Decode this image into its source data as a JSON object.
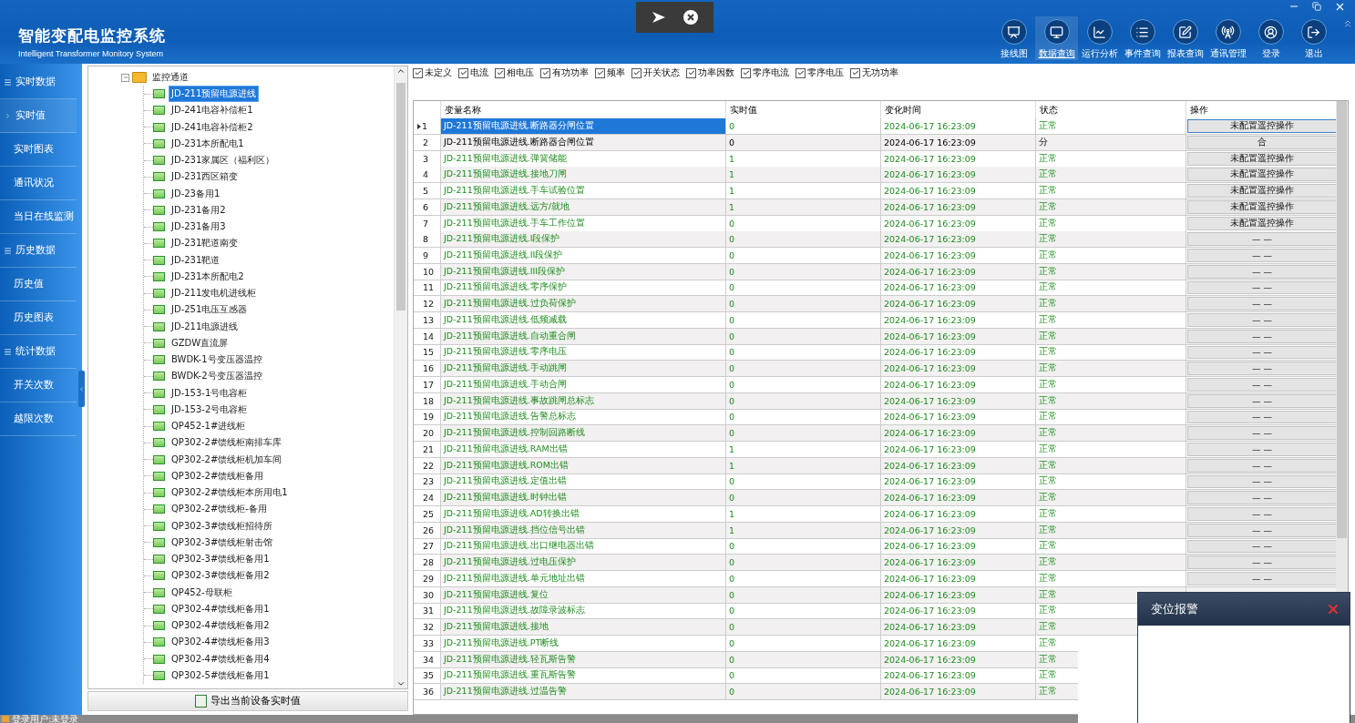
{
  "header": {
    "title": "智能变配电监控系统",
    "subtitle": "Intelligent Transformer Monitory System"
  },
  "toolbar": [
    {
      "label": "接线图",
      "selected": false
    },
    {
      "label": "数据查询",
      "selected": true
    },
    {
      "label": "运行分析",
      "selected": false
    },
    {
      "label": "事件查询",
      "selected": false
    },
    {
      "label": "报表查询",
      "selected": false
    },
    {
      "label": "通讯管理",
      "selected": false
    },
    {
      "label": "登录",
      "selected": false
    },
    {
      "label": "退出",
      "selected": false
    }
  ],
  "nav": [
    {
      "label": "实时数据",
      "kind": "section",
      "selected": false
    },
    {
      "label": "实时值",
      "kind": "item",
      "selected": true
    },
    {
      "label": "实时图表",
      "kind": "item",
      "selected": false
    },
    {
      "label": "通讯状况",
      "kind": "item",
      "selected": false
    },
    {
      "label": "当日在线监测",
      "kind": "item",
      "selected": false
    },
    {
      "label": "历史数据",
      "kind": "section",
      "selected": false
    },
    {
      "label": "历史值",
      "kind": "item",
      "selected": false
    },
    {
      "label": "历史图表",
      "kind": "item",
      "selected": false
    },
    {
      "label": "统计数据",
      "kind": "section",
      "selected": false
    },
    {
      "label": "开关次数",
      "kind": "item",
      "selected": false
    },
    {
      "label": "越限次数",
      "kind": "item",
      "selected": false
    }
  ],
  "tree": {
    "label": "监控通道",
    "expanded": true,
    "children": [
      {
        "label": "JD-211预留电源进线",
        "selected": true
      },
      {
        "label": "JD-241电容补偿柜1",
        "selected": false
      },
      {
        "label": "JD-241电容补偿柜2",
        "selected": false
      },
      {
        "label": "JD-231本所配电1",
        "selected": false
      },
      {
        "label": "JD-231家属区（福利区）",
        "selected": false
      },
      {
        "label": "JD-231西区箱变",
        "selected": false
      },
      {
        "label": "JD-23备用1",
        "selected": false
      },
      {
        "label": "JD-231备用2",
        "selected": false
      },
      {
        "label": "JD-231备用3",
        "selected": false
      },
      {
        "label": "JD-231靶道南变",
        "selected": false
      },
      {
        "label": "JD-231靶道",
        "selected": false
      },
      {
        "label": "JD-231本所配电2",
        "selected": false
      },
      {
        "label": "JD-211发电机进线柜",
        "selected": false
      },
      {
        "label": "JD-251电压互感器",
        "selected": false
      },
      {
        "label": "JD-211电源进线",
        "selected": false
      },
      {
        "label": "GZDW直流屏",
        "selected": false
      },
      {
        "label": "BWDK-1号变压器温控",
        "selected": false
      },
      {
        "label": "BWDK-2号变压器温控",
        "selected": false
      },
      {
        "label": "JD-153-1号电容柜",
        "selected": false
      },
      {
        "label": "JD-153-2号电容柜",
        "selected": false
      },
      {
        "label": "QP452-1#进线柜",
        "selected": false
      },
      {
        "label": "QP302-2#馈线柜南排车库",
        "selected": false
      },
      {
        "label": "QP302-2#馈线柜机加车间",
        "selected": false
      },
      {
        "label": "QP302-2#馈线柜备用",
        "selected": false
      },
      {
        "label": "QP302-2#馈线柜本所用电1",
        "selected": false
      },
      {
        "label": "QP302-2#馈线柜-备用",
        "selected": false
      },
      {
        "label": "QP302-3#馈线柜招待所",
        "selected": false
      },
      {
        "label": "QP302-3#馈线柜射击馆",
        "selected": false
      },
      {
        "label": "QP302-3#馈线柜备用1",
        "selected": false
      },
      {
        "label": "QP302-3#馈线柜备用2",
        "selected": false
      },
      {
        "label": "QP452-母联柜",
        "selected": false
      },
      {
        "label": "QP302-4#馈线柜备用1",
        "selected": false
      },
      {
        "label": "QP302-4#馈线柜备用2",
        "selected": false
      },
      {
        "label": "QP302-4#馈线柜备用3",
        "selected": false
      },
      {
        "label": "QP302-4#馈线柜备用4",
        "selected": false
      },
      {
        "label": "QP302-5#馈线柜备用1",
        "selected": false
      }
    ]
  },
  "export_button": "导出当前设备实时值",
  "filters": [
    {
      "label": "未定义",
      "checked": true
    },
    {
      "label": "电流",
      "checked": true
    },
    {
      "label": "相电压",
      "checked": true
    },
    {
      "label": "有功功率",
      "checked": true
    },
    {
      "label": "频率",
      "checked": true
    },
    {
      "label": "开关状态",
      "checked": true
    },
    {
      "label": "功率因数",
      "checked": true
    },
    {
      "label": "零序电流",
      "checked": true
    },
    {
      "label": "零序电压",
      "checked": true
    },
    {
      "label": "无功功率",
      "checked": true
    }
  ],
  "table": {
    "columns": [
      "变量名称",
      "实时值",
      "变化时间",
      "状态",
      "操作"
    ],
    "rows": [
      {
        "num": "1",
        "name": "JD-211预留电源进线.断路器分闸位置",
        "value": "0",
        "time": "2024-06-17 16:23:09",
        "status": "正常",
        "op": "未配置遥控操作",
        "changed": false,
        "selected": true
      },
      {
        "num": "2",
        "name": "JD-211预留电源进线.断路器合闸位置",
        "value": "0",
        "time": "2024-06-17 16:23:09",
        "status": "分",
        "op": "合",
        "changed": true,
        "selected": false
      },
      {
        "num": "3",
        "name": "JD-211预留电源进线.弹簧储能",
        "value": "1",
        "time": "2024-06-17 16:23:09",
        "status": "正常",
        "op": "未配置遥控操作",
        "changed": false,
        "selected": false
      },
      {
        "num": "4",
        "name": "JD-211预留电源进线.接地刀闸",
        "value": "1",
        "time": "2024-06-17 16:23:09",
        "status": "正常",
        "op": "未配置遥控操作",
        "changed": false,
        "selected": false
      },
      {
        "num": "5",
        "name": "JD-211预留电源进线.手车试验位置",
        "value": "1",
        "time": "2024-06-17 16:23:09",
        "status": "正常",
        "op": "未配置遥控操作",
        "changed": false,
        "selected": false
      },
      {
        "num": "6",
        "name": "JD-211预留电源进线.远方/就地",
        "value": "1",
        "time": "2024-06-17 16:23:09",
        "status": "正常",
        "op": "未配置遥控操作",
        "changed": false,
        "selected": false
      },
      {
        "num": "7",
        "name": "JD-211预留电源进线.手车工作位置",
        "value": "0",
        "time": "2024-06-17 16:23:09",
        "status": "正常",
        "op": "未配置遥控操作",
        "changed": false,
        "selected": false
      },
      {
        "num": "8",
        "name": "JD-211预留电源进线.I段保护",
        "value": "0",
        "time": "2024-06-17 16:23:09",
        "status": "正常",
        "op": "— —",
        "changed": false,
        "selected": false
      },
      {
        "num": "9",
        "name": "JD-211预留电源进线.II段保护",
        "value": "0",
        "time": "2024-06-17 16:23:09",
        "status": "正常",
        "op": "— —",
        "changed": false,
        "selected": false
      },
      {
        "num": "10",
        "name": "JD-211预留电源进线.III段保护",
        "value": "0",
        "time": "2024-06-17 16:23:09",
        "status": "正常",
        "op": "— —",
        "changed": false,
        "selected": false
      },
      {
        "num": "11",
        "name": "JD-211预留电源进线.零序保护",
        "value": "0",
        "time": "2024-06-17 16:23:09",
        "status": "正常",
        "op": "— —",
        "changed": false,
        "selected": false
      },
      {
        "num": "12",
        "name": "JD-211预留电源进线.过负荷保护",
        "value": "0",
        "time": "2024-06-17 16:23:09",
        "status": "正常",
        "op": "— —",
        "changed": false,
        "selected": false
      },
      {
        "num": "13",
        "name": "JD-211预留电源进线.低频减载",
        "value": "0",
        "time": "2024-06-17 16:23:09",
        "status": "正常",
        "op": "— —",
        "changed": false,
        "selected": false
      },
      {
        "num": "14",
        "name": "JD-211预留电源进线.自动重合闸",
        "value": "0",
        "time": "2024-06-17 16:23:09",
        "status": "正常",
        "op": "— —",
        "changed": false,
        "selected": false
      },
      {
        "num": "15",
        "name": "JD-211预留电源进线.零序电压",
        "value": "0",
        "time": "2024-06-17 16:23:09",
        "status": "正常",
        "op": "— —",
        "changed": false,
        "selected": false
      },
      {
        "num": "16",
        "name": "JD-211预留电源进线.手动跳闸",
        "value": "0",
        "time": "2024-06-17 16:23:09",
        "status": "正常",
        "op": "— —",
        "changed": false,
        "selected": false
      },
      {
        "num": "17",
        "name": "JD-211预留电源进线.手动合闸",
        "value": "0",
        "time": "2024-06-17 16:23:09",
        "status": "正常",
        "op": "— —",
        "changed": false,
        "selected": false
      },
      {
        "num": "18",
        "name": "JD-211预留电源进线.事故跳闸总标志",
        "value": "0",
        "time": "2024-06-17 16:23:09",
        "status": "正常",
        "op": "— —",
        "changed": false,
        "selected": false
      },
      {
        "num": "19",
        "name": "JD-211预留电源进线.告警总标志",
        "value": "0",
        "time": "2024-06-17 16:23:09",
        "status": "正常",
        "op": "— —",
        "changed": false,
        "selected": false
      },
      {
        "num": "20",
        "name": "JD-211预留电源进线.控制回路断线",
        "value": "0",
        "time": "2024-06-17 16:23:09",
        "status": "正常",
        "op": "— —",
        "changed": false,
        "selected": false
      },
      {
        "num": "21",
        "name": "JD-211预留电源进线.RAM出错",
        "value": "1",
        "time": "2024-06-17 16:23:09",
        "status": "正常",
        "op": "— —",
        "changed": false,
        "selected": false
      },
      {
        "num": "22",
        "name": "JD-211预留电源进线.ROM出错",
        "value": "1",
        "time": "2024-06-17 16:23:09",
        "status": "正常",
        "op": "— —",
        "changed": false,
        "selected": false
      },
      {
        "num": "23",
        "name": "JD-211预留电源进线.定值出错",
        "value": "0",
        "time": "2024-06-17 16:23:09",
        "status": "正常",
        "op": "— —",
        "changed": false,
        "selected": false
      },
      {
        "num": "24",
        "name": "JD-211预留电源进线.时钟出错",
        "value": "0",
        "time": "2024-06-17 16:23:09",
        "status": "正常",
        "op": "— —",
        "changed": false,
        "selected": false
      },
      {
        "num": "25",
        "name": "JD-211预留电源进线.AD转换出错",
        "value": "1",
        "time": "2024-06-17 16:23:09",
        "status": "正常",
        "op": "— —",
        "changed": false,
        "selected": false
      },
      {
        "num": "26",
        "name": "JD-211预留电源进线.挡位信号出错",
        "value": "1",
        "time": "2024-06-17 16:23:09",
        "status": "正常",
        "op": "— —",
        "changed": false,
        "selected": false
      },
      {
        "num": "27",
        "name": "JD-211预留电源进线.出口继电器出错",
        "value": "0",
        "time": "2024-06-17 16:23:09",
        "status": "正常",
        "op": "— —",
        "changed": false,
        "selected": false
      },
      {
        "num": "28",
        "name": "JD-211预留电源进线.过电压保护",
        "value": "0",
        "time": "2024-06-17 16:23:09",
        "status": "正常",
        "op": "— —",
        "changed": false,
        "selected": false
      },
      {
        "num": "29",
        "name": "JD-211预留电源进线.单元地址出错",
        "value": "0",
        "time": "2024-06-17 16:23:09",
        "status": "正常",
        "op": "— —",
        "changed": false,
        "selected": false
      },
      {
        "num": "30",
        "name": "JD-211预留电源进线.复位",
        "value": "0",
        "time": "2024-06-17 16:23:09",
        "status": "正常",
        "changed": false,
        "selected": false
      },
      {
        "num": "31",
        "name": "JD-211预留电源进线.故障录波标志",
        "value": "0",
        "time": "2024-06-17 16:23:09",
        "status": "正常",
        "changed": false,
        "selected": false
      },
      {
        "num": "32",
        "name": "JD-211预留电源进线.接地",
        "value": "0",
        "time": "2024-06-17 16:23:09",
        "status": "正常",
        "changed": false,
        "selected": false
      },
      {
        "num": "33",
        "name": "JD-211预留电源进线.PT断线",
        "value": "0",
        "time": "2024-06-17 16:23:09",
        "status": "正常",
        "changed": false,
        "selected": false
      },
      {
        "num": "34",
        "name": "JD-211预留电源进线.轻瓦斯告警",
        "value": "0",
        "time": "2024-06-17 16:23:09",
        "status": "正常",
        "changed": false,
        "selected": false
      },
      {
        "num": "35",
        "name": "JD-211预留电源进线.重瓦斯告警",
        "value": "0",
        "time": "2024-06-17 16:23:09",
        "status": "正常",
        "changed": false,
        "selected": false
      },
      {
        "num": "36",
        "name": "JD-211预留电源进线.过温告警",
        "value": "0",
        "time": "2024-06-17 16:23:09",
        "status": "正常",
        "changed": false,
        "selected": false
      }
    ]
  },
  "alarm_popup": {
    "title": "变位报警"
  },
  "status_bar": "登录用户:未登录"
}
